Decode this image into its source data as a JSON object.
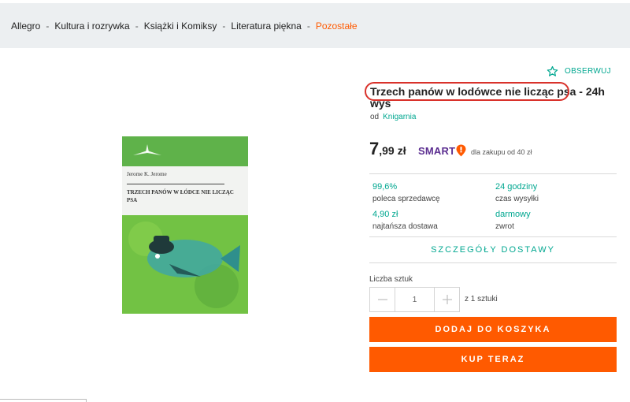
{
  "breadcrumb": {
    "items": [
      "Allegro",
      "Kultura i rozrywka",
      "Książki i Komiksy",
      "Literatura piękna",
      "Pozostałe"
    ],
    "separator": "-"
  },
  "product": {
    "image_icon": "book-cover-image",
    "cover_author": "Jerome K. Jerome",
    "cover_title": "TRZECH PANÓW W ŁÓDCE NIE LICZĄC PSA",
    "title_circled": "Trzech panów w lodówce nie licząc psa",
    "title_rest": " - 24h wys",
    "seller_prefix": "od",
    "seller_name": "Knigarnia"
  },
  "watch": {
    "label": "OBSERWUJ",
    "icon": "star-outline-icon"
  },
  "price": {
    "integer": "7",
    "decimal": ",99",
    "currency": "zł"
  },
  "smart": {
    "label": "SMART",
    "icon": "smart-pin-icon",
    "note": "dla zakupu od 40 zł"
  },
  "stats": [
    {
      "value": "99,6%",
      "label": "poleca sprzedawcę"
    },
    {
      "value": "24 godziny",
      "label": "czas wysyłki"
    },
    {
      "value": "4,90 zł",
      "label": "najtańsza dostawa"
    },
    {
      "value": "darmowy",
      "label": "zwrot"
    }
  ],
  "delivery_details_label": "SZCZEGÓŁY DOSTAWY",
  "quantity": {
    "label": "Liczba sztuk",
    "value": "1",
    "minus_icon": "minus-icon",
    "plus_icon": "plus-icon",
    "note": "z 1 sztuki"
  },
  "buttons": {
    "add_to_cart": "DODAJ DO KOSZYKA",
    "buy_now": "KUP TERAZ"
  },
  "colors": {
    "accent": "#00a790",
    "orange": "#ff5a00",
    "smart_purple": "#5b2d90",
    "annotation_red": "#d9322b"
  }
}
